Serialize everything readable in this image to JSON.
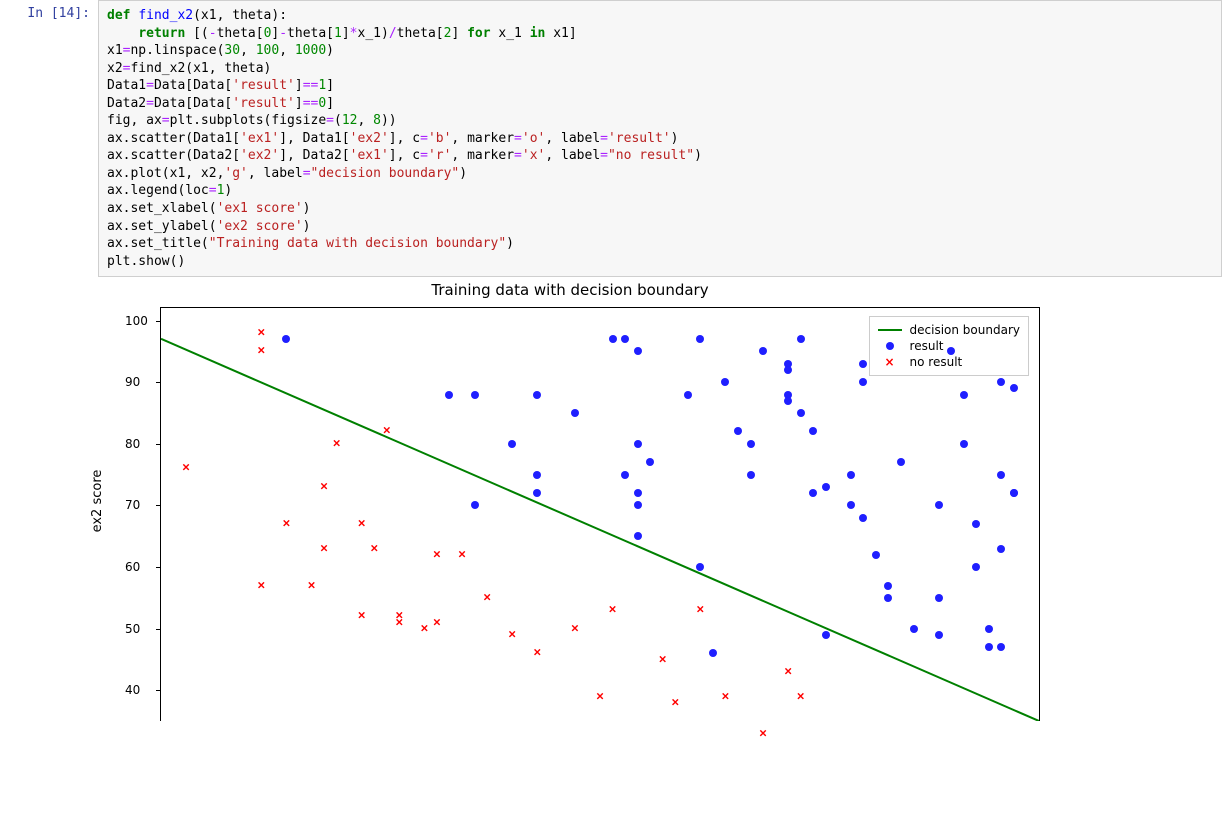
{
  "prompt": {
    "label": "In  [14]:"
  },
  "code": [
    [
      {
        "t": "def ",
        "c": "kw"
      },
      {
        "t": "find_x2",
        "c": "fn"
      },
      {
        "t": "(x1, theta):",
        "c": "txt"
      }
    ],
    [
      {
        "t": "    ",
        "c": "txt"
      },
      {
        "t": "return",
        "c": "kw"
      },
      {
        "t": " [(",
        "c": "txt"
      },
      {
        "t": "-",
        "c": "op"
      },
      {
        "t": "theta[",
        "c": "txt"
      },
      {
        "t": "0",
        "c": "num"
      },
      {
        "t": "]",
        "c": "txt"
      },
      {
        "t": "-",
        "c": "op"
      },
      {
        "t": "theta[",
        "c": "txt"
      },
      {
        "t": "1",
        "c": "num"
      },
      {
        "t": "]",
        "c": "txt"
      },
      {
        "t": "*",
        "c": "op"
      },
      {
        "t": "x_1)",
        "c": "txt"
      },
      {
        "t": "/",
        "c": "op"
      },
      {
        "t": "theta[",
        "c": "txt"
      },
      {
        "t": "2",
        "c": "num"
      },
      {
        "t": "] ",
        "c": "txt"
      },
      {
        "t": "for",
        "c": "kw"
      },
      {
        "t": " x_1 ",
        "c": "txt"
      },
      {
        "t": "in",
        "c": "kw"
      },
      {
        "t": " x1]",
        "c": "txt"
      }
    ],
    [
      {
        "t": "x1",
        "c": "txt"
      },
      {
        "t": "=",
        "c": "op"
      },
      {
        "t": "np.linspace(",
        "c": "txt"
      },
      {
        "t": "30",
        "c": "num"
      },
      {
        "t": ", ",
        "c": "txt"
      },
      {
        "t": "100",
        "c": "num"
      },
      {
        "t": ", ",
        "c": "txt"
      },
      {
        "t": "1000",
        "c": "num"
      },
      {
        "t": ")",
        "c": "txt"
      }
    ],
    [
      {
        "t": "x2",
        "c": "txt"
      },
      {
        "t": "=",
        "c": "op"
      },
      {
        "t": "find_x2(x1, theta)",
        "c": "txt"
      }
    ],
    [
      {
        "t": "Data1",
        "c": "txt"
      },
      {
        "t": "=",
        "c": "op"
      },
      {
        "t": "Data[Data[",
        "c": "txt"
      },
      {
        "t": "'result'",
        "c": "str"
      },
      {
        "t": "]",
        "c": "txt"
      },
      {
        "t": "==",
        "c": "op"
      },
      {
        "t": "1",
        "c": "num"
      },
      {
        "t": "]",
        "c": "txt"
      }
    ],
    [
      {
        "t": "Data2",
        "c": "txt"
      },
      {
        "t": "=",
        "c": "op"
      },
      {
        "t": "Data[Data[",
        "c": "txt"
      },
      {
        "t": "'result'",
        "c": "str"
      },
      {
        "t": "]",
        "c": "txt"
      },
      {
        "t": "==",
        "c": "op"
      },
      {
        "t": "0",
        "c": "num"
      },
      {
        "t": "]",
        "c": "txt"
      }
    ],
    [
      {
        "t": "fig, ax",
        "c": "txt"
      },
      {
        "t": "=",
        "c": "op"
      },
      {
        "t": "plt.subplots(figsize",
        "c": "txt"
      },
      {
        "t": "=",
        "c": "op"
      },
      {
        "t": "(",
        "c": "txt"
      },
      {
        "t": "12",
        "c": "num"
      },
      {
        "t": ", ",
        "c": "txt"
      },
      {
        "t": "8",
        "c": "num"
      },
      {
        "t": "))",
        "c": "txt"
      }
    ],
    [
      {
        "t": "ax.scatter(Data1[",
        "c": "txt"
      },
      {
        "t": "'ex1'",
        "c": "str"
      },
      {
        "t": "], Data1[",
        "c": "txt"
      },
      {
        "t": "'ex2'",
        "c": "str"
      },
      {
        "t": "], c",
        "c": "txt"
      },
      {
        "t": "=",
        "c": "op"
      },
      {
        "t": "'b'",
        "c": "str"
      },
      {
        "t": ", marker",
        "c": "txt"
      },
      {
        "t": "=",
        "c": "op"
      },
      {
        "t": "'o'",
        "c": "str"
      },
      {
        "t": ", label",
        "c": "txt"
      },
      {
        "t": "=",
        "c": "op"
      },
      {
        "t": "'result'",
        "c": "str"
      },
      {
        "t": ")",
        "c": "txt"
      }
    ],
    [
      {
        "t": "ax.scatter(Data2[",
        "c": "txt"
      },
      {
        "t": "'ex2'",
        "c": "str"
      },
      {
        "t": "], Data2[",
        "c": "txt"
      },
      {
        "t": "'ex1'",
        "c": "str"
      },
      {
        "t": "], c",
        "c": "txt"
      },
      {
        "t": "=",
        "c": "op"
      },
      {
        "t": "'r'",
        "c": "str"
      },
      {
        "t": ", marker",
        "c": "txt"
      },
      {
        "t": "=",
        "c": "op"
      },
      {
        "t": "'x'",
        "c": "str"
      },
      {
        "t": ", label",
        "c": "txt"
      },
      {
        "t": "=",
        "c": "op"
      },
      {
        "t": "\"no result\"",
        "c": "str"
      },
      {
        "t": ")",
        "c": "txt"
      }
    ],
    [
      {
        "t": "ax.plot(x1, x2,",
        "c": "txt"
      },
      {
        "t": "'g'",
        "c": "str"
      },
      {
        "t": ", label",
        "c": "txt"
      },
      {
        "t": "=",
        "c": "op"
      },
      {
        "t": "\"decision boundary\"",
        "c": "str"
      },
      {
        "t": ")",
        "c": "txt"
      }
    ],
    [
      {
        "t": "ax.legend(loc",
        "c": "txt"
      },
      {
        "t": "=",
        "c": "op"
      },
      {
        "t": "1",
        "c": "num"
      },
      {
        "t": ")",
        "c": "txt"
      }
    ],
    [
      {
        "t": "ax.set_xlabel(",
        "c": "txt"
      },
      {
        "t": "'ex1 score'",
        "c": "str"
      },
      {
        "t": ")",
        "c": "txt"
      }
    ],
    [
      {
        "t": "ax.set_ylabel(",
        "c": "txt"
      },
      {
        "t": "'ex2 score'",
        "c": "str"
      },
      {
        "t": ")",
        "c": "txt"
      }
    ],
    [
      {
        "t": "ax.set_title(",
        "c": "txt"
      },
      {
        "t": "\"Training data with decision boundary\"",
        "c": "str"
      },
      {
        "t": ")",
        "c": "txt"
      }
    ],
    [
      {
        "t": "plt.show()",
        "c": "txt"
      }
    ]
  ],
  "chart_data": {
    "type": "scatter",
    "title": "Training data with decision boundary",
    "xlabel": "ex1 score",
    "ylabel": "ex2 score",
    "xlim": [
      30,
      100
    ],
    "ylim": [
      35,
      102
    ],
    "yticks": [
      40,
      50,
      60,
      70,
      80,
      90,
      100
    ],
    "legend": [
      {
        "label": "decision boundary",
        "type": "line",
        "color": "#008000"
      },
      {
        "label": "result",
        "type": "dot",
        "color": "#0000ff"
      },
      {
        "label": "no result",
        "type": "cross",
        "color": "#ff0000"
      }
    ],
    "boundary": {
      "x1": 30,
      "y1": 97,
      "x2": 100,
      "y2": 35
    },
    "series": [
      {
        "name": "result",
        "marker": "dot",
        "points": [
          [
            40,
            97
          ],
          [
            53,
            88
          ],
          [
            55,
            88
          ],
          [
            60,
            88
          ],
          [
            66,
            97
          ],
          [
            67,
            97
          ],
          [
            63,
            85
          ],
          [
            68,
            95
          ],
          [
            68,
            80
          ],
          [
            67,
            75
          ],
          [
            68,
            72
          ],
          [
            68,
            70
          ],
          [
            68,
            65
          ],
          [
            69,
            77
          ],
          [
            73,
            97
          ],
          [
            75,
            90
          ],
          [
            76,
            82
          ],
          [
            77,
            80
          ],
          [
            77,
            75
          ],
          [
            78,
            95
          ],
          [
            81,
            97
          ],
          [
            80,
            93
          ],
          [
            80,
            92
          ],
          [
            80,
            88
          ],
          [
            80,
            87
          ],
          [
            81,
            85
          ],
          [
            82,
            82
          ],
          [
            82,
            72
          ],
          [
            83,
            73
          ],
          [
            85,
            75
          ],
          [
            85,
            70
          ],
          [
            86,
            93
          ],
          [
            86,
            90
          ],
          [
            87,
            62
          ],
          [
            88,
            57
          ],
          [
            88,
            55
          ],
          [
            89,
            77
          ],
          [
            90,
            50
          ],
          [
            92,
            55
          ],
          [
            92,
            70
          ],
          [
            92,
            49
          ],
          [
            93,
            95
          ],
          [
            94,
            88
          ],
          [
            94,
            80
          ],
          [
            95,
            67
          ],
          [
            96,
            47
          ],
          [
            96,
            50
          ],
          [
            95,
            60
          ],
          [
            97,
            75
          ],
          [
            97,
            63
          ],
          [
            97,
            47
          ],
          [
            98,
            72
          ],
          [
            98,
            72
          ],
          [
            98,
            89
          ],
          [
            97,
            90
          ],
          [
            86,
            68
          ],
          [
            83,
            49
          ],
          [
            74,
            46
          ],
          [
            73,
            60
          ],
          [
            60,
            72
          ],
          [
            60,
            75
          ],
          [
            58,
            80
          ],
          [
            55,
            70
          ],
          [
            72,
            88
          ]
        ]
      },
      {
        "name": "no result",
        "marker": "cross",
        "points": [
          [
            32,
            76
          ],
          [
            38,
            57
          ],
          [
            38,
            98
          ],
          [
            38,
            95
          ],
          [
            40,
            67
          ],
          [
            42,
            57
          ],
          [
            43,
            73
          ],
          [
            43,
            63
          ],
          [
            44,
            80
          ],
          [
            46,
            67
          ],
          [
            46,
            52
          ],
          [
            47,
            63
          ],
          [
            48,
            82
          ],
          [
            49,
            51
          ],
          [
            49,
            52
          ],
          [
            51,
            50
          ],
          [
            52,
            62
          ],
          [
            52,
            51
          ],
          [
            54,
            62
          ],
          [
            56,
            55
          ],
          [
            58,
            49
          ],
          [
            60,
            46
          ],
          [
            63,
            50
          ],
          [
            65,
            39
          ],
          [
            66,
            53
          ],
          [
            70,
            45
          ],
          [
            71,
            38
          ],
          [
            73,
            53
          ],
          [
            75,
            39
          ],
          [
            78,
            33
          ],
          [
            80,
            43
          ],
          [
            81,
            39
          ]
        ]
      }
    ]
  }
}
